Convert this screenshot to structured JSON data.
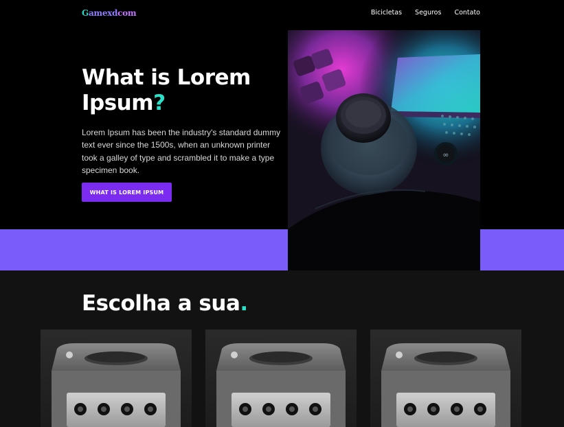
{
  "header": {
    "logo": {
      "part1": "G",
      "part2": "amexd",
      "part3": "com"
    },
    "nav": [
      "Bicicletas",
      "Seguros",
      "Contato"
    ]
  },
  "hero": {
    "title_line1": "What is Lorem",
    "title_line2": "Ipsum",
    "title_mark": "?",
    "description": "Lorem Ipsum has been the industry's standard dummy text ever since the 1500s, when an unknown printer took a galley of type and scrambled it to make a type specimen book.",
    "button_label": "WHAT IS LOREM IPSUM",
    "image": "game-controller-photo"
  },
  "section": {
    "title": "Escolha a sua",
    "title_mark": ".",
    "cards": [
      {
        "image": "gamecube-console-photo"
      },
      {
        "image": "gamecube-console-photo"
      },
      {
        "image": "gamecube-console-photo"
      }
    ]
  },
  "colors": {
    "background": "#000000",
    "accent_teal": "#2be0c8",
    "accent_purple": "#7b2cf0",
    "band_purple": "#7a5cfa",
    "section_bg": "#121212"
  }
}
